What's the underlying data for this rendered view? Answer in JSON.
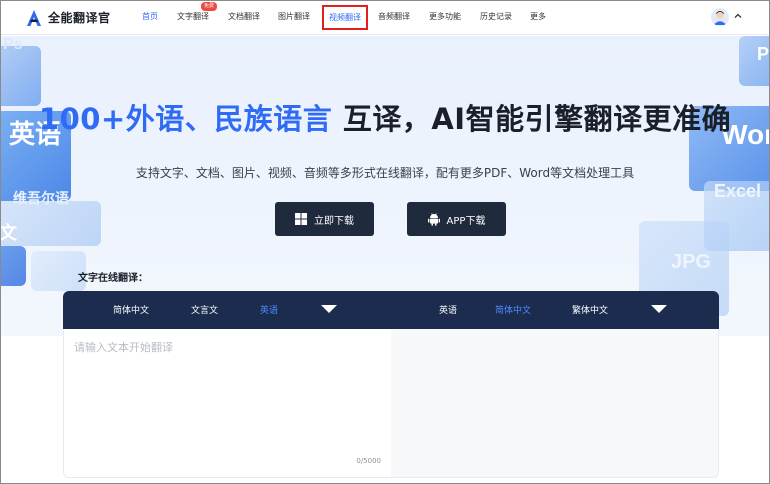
{
  "nav": {
    "logo_text": "全能翻译官",
    "items": [
      {
        "label": "首页",
        "state": "active"
      },
      {
        "label": "文字翻译",
        "badge": "免费"
      },
      {
        "label": "文档翻译"
      },
      {
        "label": "图片翻译"
      },
      {
        "label": "视频翻译",
        "state": "highlighted"
      },
      {
        "label": "音频翻译"
      },
      {
        "label": "更多功能"
      },
      {
        "label": "历史记录"
      },
      {
        "label": "更多"
      }
    ]
  },
  "hero": {
    "headline_blue": "100+外语、民族语言",
    "headline_dark": " 互译，AI智能引擎翻译更准确",
    "subline": "支持文字、文档、图片、视频、音频等多形式在线翻译，配有更多PDF、Word等文档处理工具",
    "btn_download": "立即下载",
    "btn_app": "APP下载",
    "deco_labels": {
      "en": "英语",
      "wei": "维吾尔语",
      "wen": "文",
      "word": "Wor",
      "excel": "Excel",
      "jpg": "JPG",
      "p": "P",
      "ps": "Ps"
    }
  },
  "translator": {
    "section_label": "文字在线翻译：",
    "source_langs": [
      "简体中文",
      "文言文",
      "英语"
    ],
    "source_active_index": 2,
    "target_langs": [
      "英语",
      "简体中文",
      "繁体中文"
    ],
    "target_active_index": 1,
    "input_placeholder": "请输入文本开始翻译",
    "input_value": "",
    "char_count": "0/5000"
  },
  "colors": {
    "accent": "#2f6bf5",
    "highlight_box": "#e0201c",
    "lang_bar": "#1b2c4f",
    "button_dark": "#1f2a3c"
  }
}
